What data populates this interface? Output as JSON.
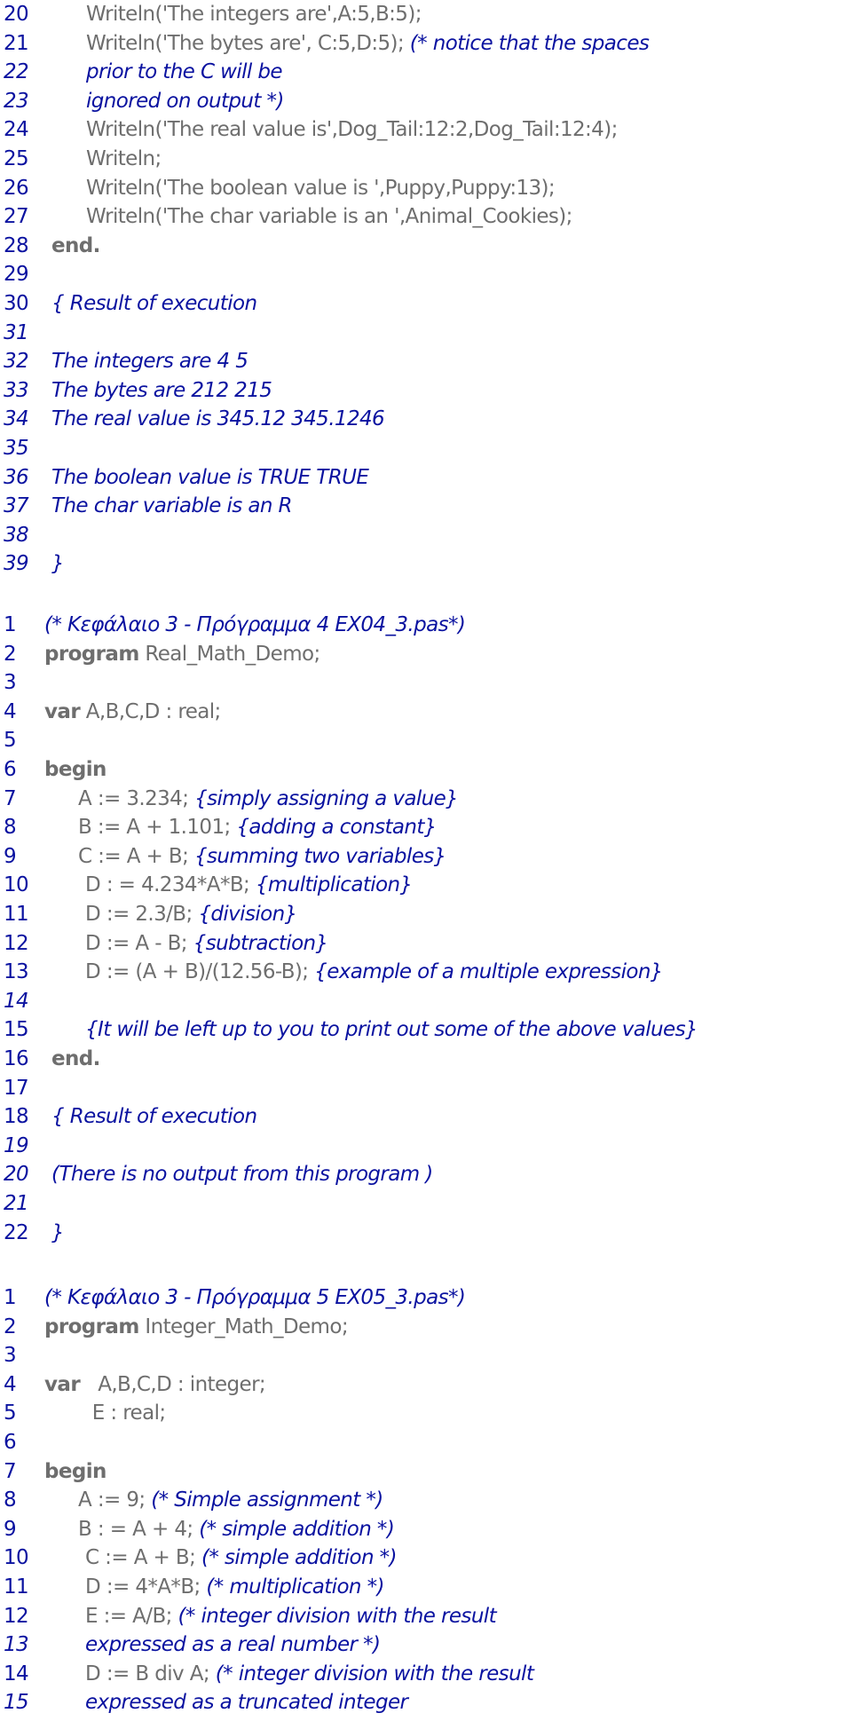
{
  "colors": {
    "line_number": "#0a12a0",
    "code": "#6e6e6e",
    "comment": "#0a12a0",
    "background": "#ffffff"
  },
  "sections": [
    {
      "name": "program-3-continued",
      "lines": [
        {
          "n": "20",
          "n_italic": false,
          "indent": 1,
          "segs": [
            {
              "t": "code",
              "v": "Writeln('The integers are',A:5,B:5);"
            }
          ]
        },
        {
          "n": "21",
          "n_italic": false,
          "indent": 1,
          "segs": [
            {
              "t": "code",
              "v": "Writeln('The bytes are', C:5,D:5); "
            },
            {
              "t": "comment",
              "v": "(* notice that the spaces"
            }
          ]
        },
        {
          "n": "22",
          "n_italic": true,
          "indent": 1,
          "segs": [
            {
              "t": "comment",
              "v": "prior to the C will be"
            }
          ]
        },
        {
          "n": "23",
          "n_italic": true,
          "indent": 1,
          "segs": [
            {
              "t": "comment",
              "v": "ignored on output *)"
            }
          ]
        },
        {
          "n": "24",
          "n_italic": false,
          "indent": 1,
          "segs": [
            {
              "t": "code",
              "v": "Writeln('The real value is',Dog_Tail:12:2,Dog_Tail:12:4);"
            }
          ]
        },
        {
          "n": "25",
          "n_italic": false,
          "indent": 1,
          "segs": [
            {
              "t": "code",
              "v": "Writeln;"
            }
          ]
        },
        {
          "n": "26",
          "n_italic": false,
          "indent": 1,
          "segs": [
            {
              "t": "code",
              "v": "Writeln('The boolean value is ',Puppy,Puppy:13);"
            }
          ]
        },
        {
          "n": "27",
          "n_italic": false,
          "indent": 1,
          "segs": [
            {
              "t": "code",
              "v": "Writeln('The char variable is an ',Animal_Cookies);"
            }
          ]
        },
        {
          "n": "28",
          "n_italic": false,
          "indent": 0,
          "segs": [
            {
              "t": "kw",
              "v": "end."
            }
          ]
        },
        {
          "n": "29",
          "n_italic": false,
          "indent": 0,
          "segs": []
        },
        {
          "n": "30",
          "n_italic": false,
          "indent": 0,
          "segs": [
            {
              "t": "comment",
              "v": "{ Result of execution"
            }
          ]
        },
        {
          "n": "31",
          "n_italic": true,
          "indent": 0,
          "segs": []
        },
        {
          "n": "32",
          "n_italic": true,
          "indent": 0,
          "segs": [
            {
              "t": "comment",
              "v": "The integers are 4 5"
            }
          ]
        },
        {
          "n": "33",
          "n_italic": true,
          "indent": 0,
          "segs": [
            {
              "t": "comment",
              "v": "The bytes are 212 215"
            }
          ]
        },
        {
          "n": "34",
          "n_italic": true,
          "indent": 0,
          "segs": [
            {
              "t": "comment",
              "v": "The real value is 345.12 345.1246"
            }
          ]
        },
        {
          "n": "35",
          "n_italic": true,
          "indent": 0,
          "segs": []
        },
        {
          "n": "36",
          "n_italic": true,
          "indent": 0,
          "segs": [
            {
              "t": "comment",
              "v": "The boolean value is TRUE TRUE"
            }
          ]
        },
        {
          "n": "37",
          "n_italic": true,
          "indent": 0,
          "segs": [
            {
              "t": "comment",
              "v": "The char variable is an R"
            }
          ]
        },
        {
          "n": "38",
          "n_italic": true,
          "indent": 0,
          "segs": []
        },
        {
          "n": "39",
          "n_italic": true,
          "indent": 0,
          "segs": [
            {
              "t": "comment",
              "v": "}"
            }
          ]
        }
      ]
    },
    {
      "name": "program-4-real-math-demo",
      "lines": [
        {
          "n": "1",
          "n_italic": false,
          "indent": 0,
          "segs": [
            {
              "t": "comment",
              "v": "(* Κεφάλαιο 3 - Πρόγραμμα 4 EX04_3.pas*)"
            }
          ]
        },
        {
          "n": "2",
          "n_italic": false,
          "indent": 0,
          "segs": [
            {
              "t": "kw",
              "v": "program"
            },
            {
              "t": "code",
              "v": " Real_Math_Demo;"
            }
          ]
        },
        {
          "n": "3",
          "n_italic": false,
          "indent": 0,
          "segs": []
        },
        {
          "n": "4",
          "n_italic": false,
          "indent": 0,
          "segs": [
            {
              "t": "kw",
              "v": "var"
            },
            {
              "t": "code",
              "v": " A,B,C,D : real;"
            }
          ]
        },
        {
          "n": "5",
          "n_italic": false,
          "indent": 0,
          "segs": []
        },
        {
          "n": "6",
          "n_italic": false,
          "indent": 0,
          "segs": [
            {
              "t": "kw",
              "v": "begin"
            }
          ]
        },
        {
          "n": "7",
          "n_italic": false,
          "indent": 1,
          "segs": [
            {
              "t": "code",
              "v": "A := 3.234; "
            },
            {
              "t": "comment",
              "v": "{simply assigning a value}"
            }
          ]
        },
        {
          "n": "8",
          "n_italic": false,
          "indent": 1,
          "segs": [
            {
              "t": "code",
              "v": "B := A + 1.101; "
            },
            {
              "t": "comment",
              "v": "{adding a constant}"
            }
          ]
        },
        {
          "n": "9",
          "n_italic": false,
          "indent": 1,
          "segs": [
            {
              "t": "code",
              "v": "C := A + B; "
            },
            {
              "t": "comment",
              "v": "{summing two variables}"
            }
          ]
        },
        {
          "n": "10",
          "n_italic": false,
          "indent": 1,
          "segs": [
            {
              "t": "code",
              "v": "D : = 4.234*A*B; "
            },
            {
              "t": "comment",
              "v": "{multiplication}"
            }
          ]
        },
        {
          "n": "11",
          "n_italic": false,
          "indent": 1,
          "segs": [
            {
              "t": "code",
              "v": "D := 2.3/B; "
            },
            {
              "t": "comment",
              "v": "{division}"
            }
          ]
        },
        {
          "n": "12",
          "n_italic": false,
          "indent": 1,
          "segs": [
            {
              "t": "code",
              "v": "D := A - B; "
            },
            {
              "t": "comment",
              "v": "{subtraction}"
            }
          ]
        },
        {
          "n": "13",
          "n_italic": false,
          "indent": 1,
          "segs": [
            {
              "t": "code",
              "v": "D := (A + B)/(12.56-B); "
            },
            {
              "t": "comment",
              "v": "{example of a multiple expression}"
            }
          ]
        },
        {
          "n": "14",
          "n_italic": true,
          "indent": 0,
          "segs": []
        },
        {
          "n": "15",
          "n_italic": false,
          "indent": 1,
          "segs": [
            {
              "t": "comment",
              "v": "{It will be left up to you to print out some of the above values}"
            }
          ]
        },
        {
          "n": "16",
          "n_italic": false,
          "indent": 0,
          "segs": [
            {
              "t": "kw",
              "v": "end."
            }
          ]
        },
        {
          "n": "17",
          "n_italic": false,
          "indent": 0,
          "segs": []
        },
        {
          "n": "18",
          "n_italic": false,
          "indent": 0,
          "segs": [
            {
              "t": "comment",
              "v": "{ Result of execution"
            }
          ]
        },
        {
          "n": "19",
          "n_italic": true,
          "indent": 0,
          "segs": []
        },
        {
          "n": "20",
          "n_italic": true,
          "indent": 0,
          "segs": [
            {
              "t": "comment",
              "v": "(There is no output from this program )"
            }
          ]
        },
        {
          "n": "21",
          "n_italic": true,
          "indent": 0,
          "segs": []
        },
        {
          "n": "22",
          "n_italic": false,
          "indent": 0,
          "segs": [
            {
              "t": "comment",
              "v": "}"
            }
          ]
        }
      ]
    },
    {
      "name": "program-5-integer-math-demo",
      "lines": [
        {
          "n": "1",
          "n_italic": false,
          "indent": 0,
          "segs": [
            {
              "t": "comment",
              "v": "(* Κεφάλαιο 3 - Πρόγραμμα 5 EX05_3.pas*)"
            }
          ]
        },
        {
          "n": "2",
          "n_italic": false,
          "indent": 0,
          "segs": [
            {
              "t": "kw",
              "v": "program"
            },
            {
              "t": "code",
              "v": " Integer_Math_Demo;"
            }
          ]
        },
        {
          "n": "3",
          "n_italic": false,
          "indent": 0,
          "segs": []
        },
        {
          "n": "4",
          "n_italic": false,
          "indent": 0,
          "segs": [
            {
              "t": "kw",
              "v": "var"
            },
            {
              "t": "code",
              "v": "   A,B,C,D : integer;"
            }
          ]
        },
        {
          "n": "5",
          "n_italic": false,
          "indent": 0,
          "segs": [
            {
              "t": "code",
              "v": "        E : real;"
            }
          ]
        },
        {
          "n": "6",
          "n_italic": false,
          "indent": 0,
          "segs": []
        },
        {
          "n": "7",
          "n_italic": false,
          "indent": 0,
          "segs": [
            {
              "t": "kw",
              "v": "begin"
            }
          ]
        },
        {
          "n": "8",
          "n_italic": false,
          "indent": 1,
          "segs": [
            {
              "t": "code",
              "v": "A := 9; "
            },
            {
              "t": "comment",
              "v": "(* Simple assignment *)"
            }
          ]
        },
        {
          "n": "9",
          "n_italic": false,
          "indent": 1,
          "segs": [
            {
              "t": "code",
              "v": "B : = A + 4; "
            },
            {
              "t": "comment",
              "v": "(* simple addition *)"
            }
          ]
        },
        {
          "n": "10",
          "n_italic": false,
          "indent": 1,
          "segs": [
            {
              "t": "code",
              "v": "C := A + B; "
            },
            {
              "t": "comment",
              "v": "(* simple addition *)"
            }
          ]
        },
        {
          "n": "11",
          "n_italic": false,
          "indent": 1,
          "segs": [
            {
              "t": "code",
              "v": "D := 4*A*B; "
            },
            {
              "t": "comment",
              "v": "(* multiplication *)"
            }
          ]
        },
        {
          "n": "12",
          "n_italic": false,
          "indent": 1,
          "segs": [
            {
              "t": "code",
              "v": "E := A/B; "
            },
            {
              "t": "comment",
              "v": "(* integer division with the result"
            }
          ]
        },
        {
          "n": "13",
          "n_italic": true,
          "indent": 1,
          "segs": [
            {
              "t": "comment",
              "v": "expressed as a real number *)"
            }
          ]
        },
        {
          "n": "14",
          "n_italic": false,
          "indent": 1,
          "segs": [
            {
              "t": "code",
              "v": "D := B div A; "
            },
            {
              "t": "comment",
              "v": "(* integer division with the result"
            }
          ]
        },
        {
          "n": "15",
          "n_italic": true,
          "indent": 1,
          "segs": [
            {
              "t": "comment",
              "v": "expressed as a truncated integer"
            }
          ]
        }
      ]
    }
  ]
}
